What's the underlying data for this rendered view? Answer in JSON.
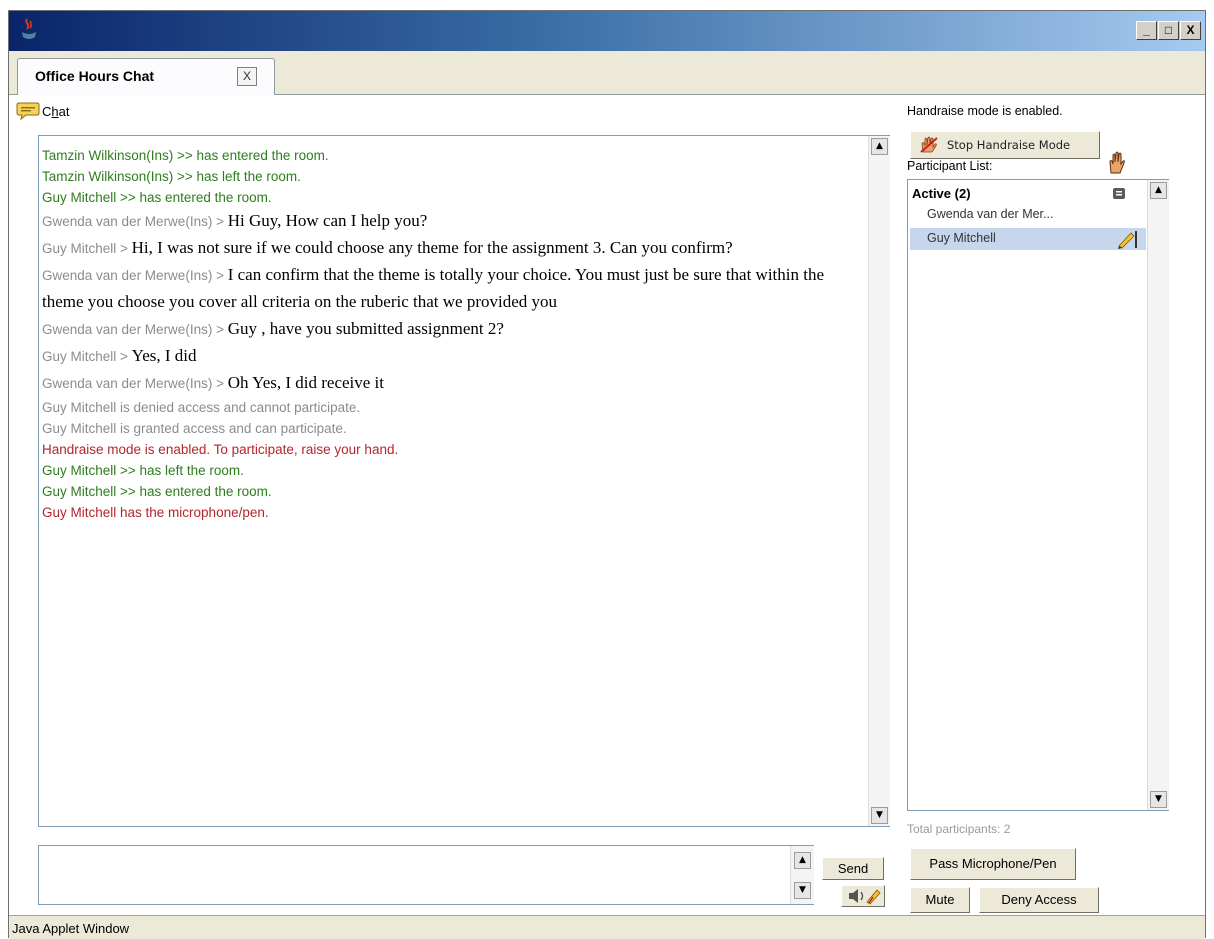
{
  "window": {
    "minimize_label": "_",
    "maximize_label": "□",
    "close_label": "X"
  },
  "tab": {
    "label": "Office Hours Chat",
    "close_label": "X"
  },
  "chat": {
    "section_label_prefix": "C",
    "section_label_mnemonic": "h",
    "section_label_suffix": "at",
    "messages": [
      {
        "type": "system",
        "color": "green",
        "text": "Tamzin Wilkinson(Ins) >> has entered the room."
      },
      {
        "type": "system",
        "color": "green",
        "text": "Tamzin Wilkinson(Ins) >> has left the room."
      },
      {
        "type": "system",
        "color": "green",
        "text": "Guy Mitchell >> has entered the room."
      },
      {
        "type": "chat",
        "speaker": "Gwenda van der Merwe(Ins) > ",
        "text": "Hi Guy, How can I help you?"
      },
      {
        "type": "chat",
        "speaker": "Guy Mitchell > ",
        "text": "Hi, I was not sure if we could choose any theme for the assignment 3. Can you confirm?"
      },
      {
        "type": "chat",
        "speaker": "Gwenda van der Merwe(Ins) > ",
        "text": "I can confirm that the theme is totally your choice. You must just be sure that within the theme you choose you cover all criteria on the ruberic that we provided you"
      },
      {
        "type": "chat",
        "speaker": "Gwenda van der Merwe(Ins) > ",
        "text": "Guy , have you submitted assignment 2?"
      },
      {
        "type": "chat",
        "speaker": "Guy Mitchell > ",
        "text": "Yes, I did"
      },
      {
        "type": "chat",
        "speaker": "Gwenda van der Merwe(Ins) > ",
        "text": "Oh Yes, I did receive it"
      },
      {
        "type": "system",
        "color": "gray",
        "text": "Guy Mitchell is denied access and cannot participate."
      },
      {
        "type": "system",
        "color": "gray",
        "text": "Guy Mitchell is granted access and can participate."
      },
      {
        "type": "system",
        "color": "red",
        "text": "Handraise mode is enabled. To participate, raise your hand."
      },
      {
        "type": "system",
        "color": "green",
        "text": "Guy Mitchell >> has left the room."
      },
      {
        "type": "system",
        "color": "green",
        "text": "Guy Mitchell >> has entered the room."
      },
      {
        "type": "system",
        "color": "red",
        "text": "Guy Mitchell has the microphone/pen."
      }
    ],
    "input_value": "",
    "send_label": "Send"
  },
  "right_panel": {
    "status_text": "Handraise mode is enabled.",
    "stop_handraise_label": "Stop Handraise Mode",
    "participant_list_label": "Participant List:",
    "group_label": "Active (2)",
    "participants": [
      {
        "name": "Gwenda van der Mer...",
        "selected": false
      },
      {
        "name": "Guy Mitchell",
        "selected": true
      }
    ],
    "total_label": "Total participants: 2",
    "pass_mic_label": "Pass Microphone/Pen",
    "mute_label": "Mute",
    "deny_label": "Deny Access"
  },
  "status_bar": {
    "text": "Java Applet Window"
  },
  "colors": {
    "green": "#2e7d1f",
    "red": "#b3262c",
    "gray": "#8c8c8c",
    "selection": "#c6d6ec"
  }
}
